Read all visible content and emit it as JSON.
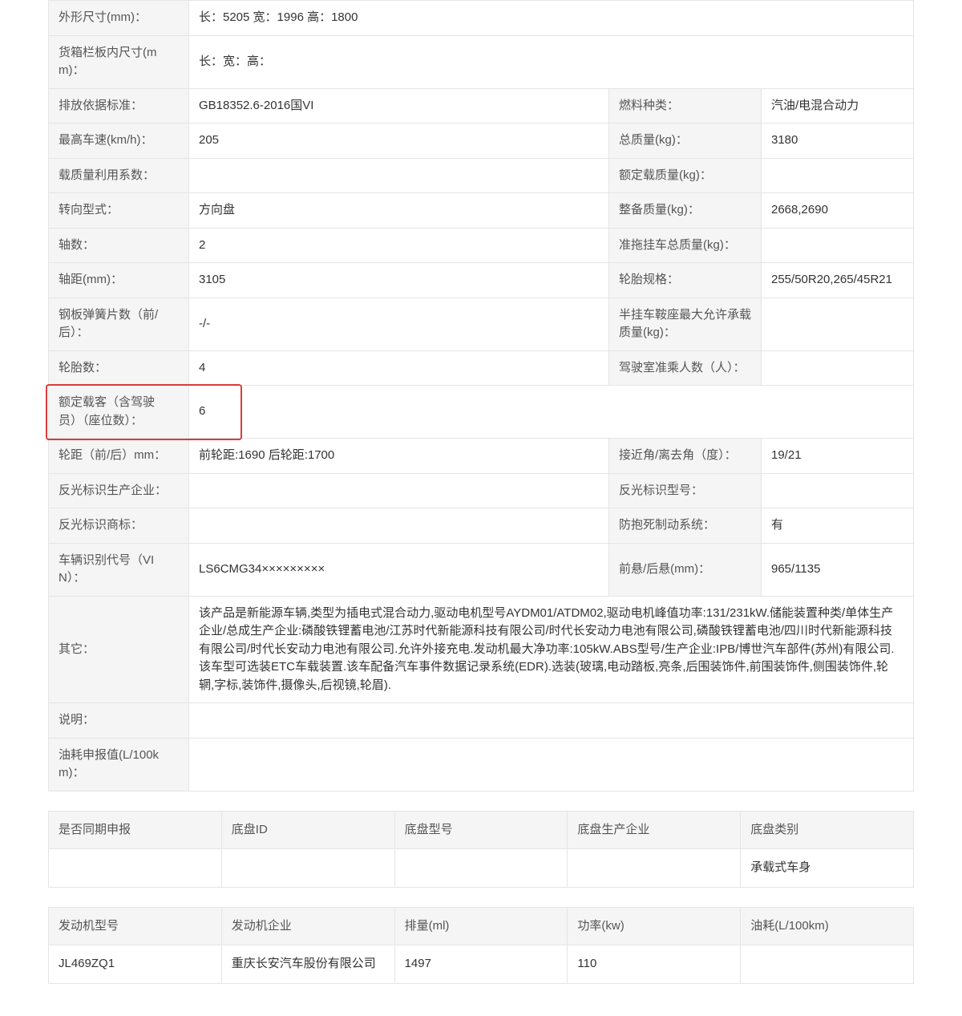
{
  "spec_rows": [
    {
      "type": "single",
      "label": "外形尺寸(mm)：",
      "value": "长：5205 宽：1996 高：1800"
    },
    {
      "type": "single",
      "label": "货箱栏板内尺寸(mm)：",
      "value": "长：宽：高："
    },
    {
      "type": "double",
      "label1": "排放依据标准：",
      "value1": "GB18352.6-2016国VI",
      "label2": "燃料种类：",
      "value2": "汽油/电混合动力"
    },
    {
      "type": "double",
      "label1": "最高车速(km/h)：",
      "value1": "205",
      "label2": "总质量(kg)：",
      "value2": "3180"
    },
    {
      "type": "double",
      "label1": "载质量利用系数：",
      "value1": "",
      "label2": "额定载质量(kg)：",
      "value2": ""
    },
    {
      "type": "double",
      "label1": "转向型式：",
      "value1": "方向盘",
      "label2": "整备质量(kg)：",
      "value2": "2668,2690"
    },
    {
      "type": "double",
      "label1": "轴数：",
      "value1": "2",
      "label2": "准拖挂车总质量(kg)：",
      "value2": ""
    },
    {
      "type": "double",
      "label1": "轴距(mm)：",
      "value1": "3105",
      "label2": "轮胎规格：",
      "value2": "255/50R20,265/45R21"
    },
    {
      "type": "double",
      "label1": "钢板弹簧片数（前/后）：",
      "value1": "-/-",
      "label2": "半挂车鞍座最大允许承载质量(kg)：",
      "value2": ""
    },
    {
      "type": "double",
      "label1": "轮胎数：",
      "value1": "4",
      "label2": "驾驶室准乘人数（人）：",
      "value2": ""
    },
    {
      "type": "highlight",
      "label1": "额定载客（含驾驶员）（座位数）：",
      "value1": "6"
    },
    {
      "type": "double",
      "label1": "轮距（前/后）mm：",
      "value1": "前轮距:1690 后轮距:1700",
      "label2": "接近角/离去角（度）：",
      "value2": "19/21"
    },
    {
      "type": "double",
      "label1": "反光标识生产企业：",
      "value1": "",
      "label2": "反光标识型号：",
      "value2": ""
    },
    {
      "type": "double",
      "label1": "反光标识商标：",
      "value1": "",
      "label2": "防抱死制动系统：",
      "value2": "有"
    },
    {
      "type": "double",
      "label1": "车辆识别代号（VIN）：",
      "value1": "LS6CMG34×××××××××",
      "label2": "前悬/后悬(mm)：",
      "value2": "965/1135"
    },
    {
      "type": "single",
      "label": "其它：",
      "value": "该产品是新能源车辆,类型为插电式混合动力,驱动电机型号AYDM01/ATDM02,驱动电机峰值功率:131/231kW.储能装置种类/单体生产企业/总成生产企业:磷酸铁锂蓄电池/江苏时代新能源科技有限公司/时代长安动力电池有限公司,磷酸铁锂蓄电池/四川时代新能源科技有限公司/时代长安动力电池有限公司.允许外接充电.发动机最大净功率:105kW.ABS型号/生产企业:IPB/博世汽车部件(苏州)有限公司.该车型可选装ETC车载装置.该车配备汽车事件数据记录系统(EDR).选装(玻璃,电动踏板,亮条,后围装饰件,前围装饰件,侧围装饰件,轮辋,字标,装饰件,摄像头,后视镜,轮眉)."
    },
    {
      "type": "single",
      "label": "说明：",
      "value": ""
    },
    {
      "type": "single",
      "label": "油耗申报值(L/100km)：",
      "value": ""
    }
  ],
  "chassis": {
    "headers": [
      "是否同期申报",
      "底盘ID",
      "底盘型号",
      "底盘生产企业",
      "底盘类别"
    ],
    "row": [
      "",
      "",
      "",
      "",
      "承载式车身"
    ]
  },
  "engine": {
    "headers": [
      "发动机型号",
      "发动机企业",
      "排量(ml)",
      "功率(kw)",
      "油耗(L/100km)"
    ],
    "row": [
      "JL469ZQ1",
      "重庆长安汽车股份有限公司",
      "1497",
      "110",
      ""
    ]
  }
}
